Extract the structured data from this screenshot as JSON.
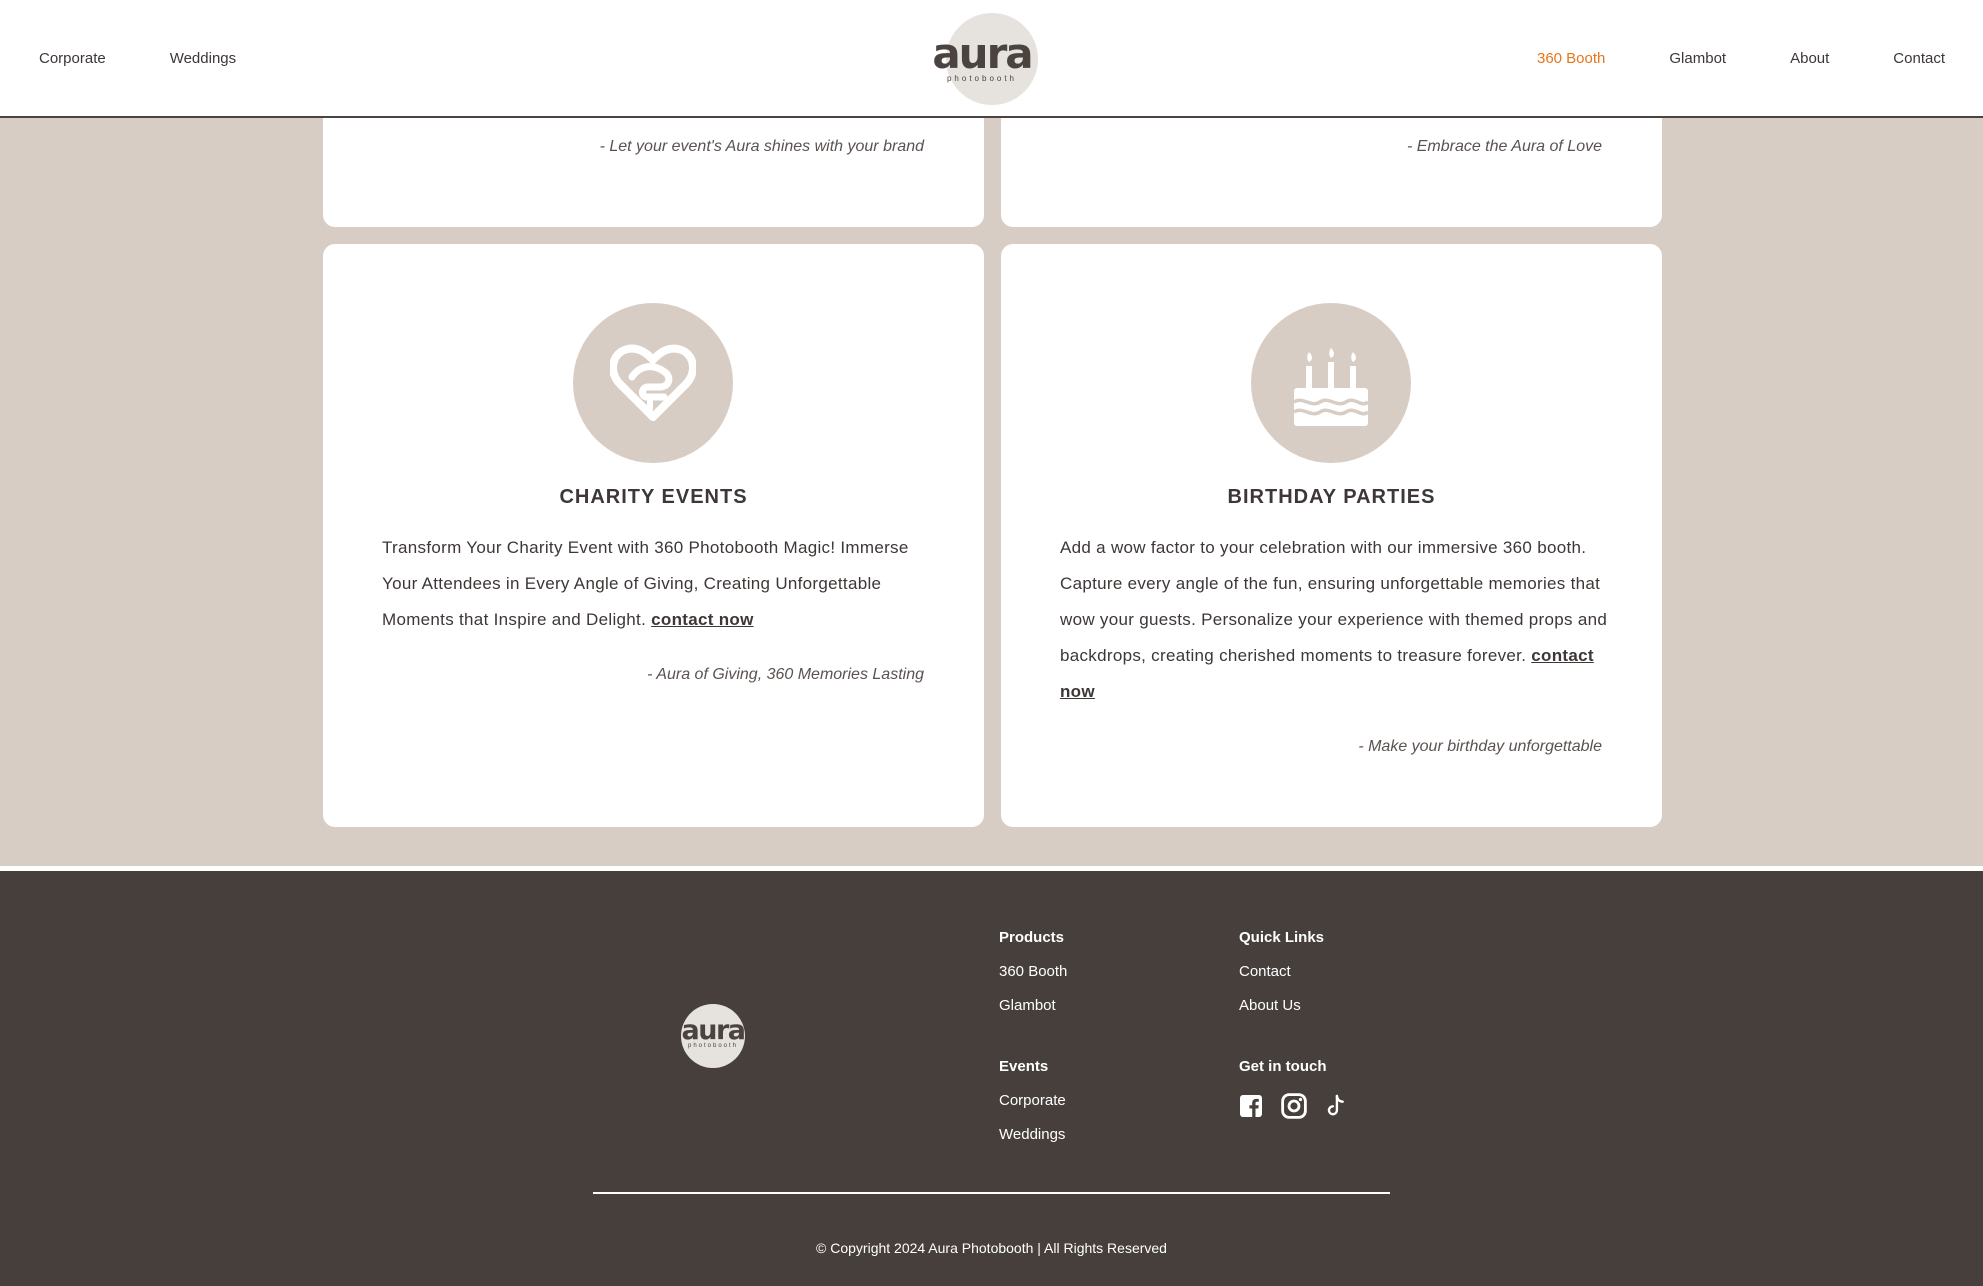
{
  "header": {
    "nav_left": [
      "Corporate",
      "Weddings"
    ],
    "nav_right": [
      "360 Booth",
      "Glambot",
      "About",
      "Contact"
    ],
    "active_item": "360 Booth",
    "active_color": "#e8761a",
    "logo": {
      "word": "aura",
      "sub": "photobooth"
    }
  },
  "cards_top": [
    {
      "tagline": "- Let your event's Aura shines with your brand"
    },
    {
      "tagline": "- Embrace the Aura of Love"
    }
  ],
  "cards": [
    {
      "icon": "heart-handshake-icon",
      "title": "CHARITY EVENTS",
      "body": "Transform Your Charity Event with 360 Photobooth Magic! Immerse Your Attendees in Every Angle of Giving, Creating Unforgettable Moments that Inspire and Delight.",
      "link": "contact now",
      "tagline": "- Aura of Giving, 360 Memories Lasting"
    },
    {
      "icon": "birthday-cake-icon",
      "title": "BIRTHDAY PARTIES",
      "body": "Add a wow factor to your celebration with our immersive 360 booth. Capture every angle of the fun, ensuring unforgettable memories that wow your guests. Personalize your experience with themed props and backdrops, creating cherished moments to treasure forever.",
      "link": "contact now",
      "tagline": "- Make your birthday unforgettable"
    }
  ],
  "footer": {
    "logo": {
      "word": "aura",
      "sub": "photobooth"
    },
    "products": {
      "heading": "Products",
      "links": [
        "360 Booth",
        "Glambot"
      ]
    },
    "quick_links": {
      "heading": "Quick Links",
      "links": [
        "Contact",
        "About Us"
      ]
    },
    "events": {
      "heading": "Events",
      "links": [
        "Corporate",
        "Weddings"
      ]
    },
    "get_in_touch": {
      "heading": "Get in touch",
      "icons": [
        "facebook-icon",
        "instagram-icon",
        "tiktok-icon"
      ]
    },
    "copyright": "© Copyright 2024 Aura Photobooth | All Rights Reserved"
  },
  "colors": {
    "background": "#d8cdc4",
    "footer": "#463f3c",
    "text": "#3d3735"
  }
}
